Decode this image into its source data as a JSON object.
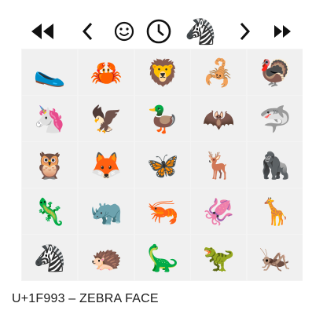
{
  "toolbar": {
    "buttons": [
      {
        "name": "first-page-button",
        "icon": "double-chevron-left-icon"
      },
      {
        "name": "previous-button",
        "icon": "chevron-left-icon"
      },
      {
        "name": "smileys-category-button",
        "icon": "smiley-icon"
      },
      {
        "name": "recent-category-button",
        "icon": "clock-icon"
      },
      {
        "name": "animals-category-button",
        "icon": "zebra-icon",
        "glyph": "🦓"
      },
      {
        "name": "next-button",
        "icon": "chevron-right-icon"
      },
      {
        "name": "last-page-button",
        "icon": "double-chevron-right-icon"
      }
    ]
  },
  "grid": {
    "emojis": [
      [
        "🥿",
        "🦀",
        "🦁",
        "🦂",
        "🦃"
      ],
      [
        "🦄",
        "🦅",
        "🦆",
        "🦇",
        "🦈"
      ],
      [
        "🦉",
        "🦊",
        "🦋",
        "🦌",
        "🦍"
      ],
      [
        "🦎",
        "🦏",
        "🦐",
        "🦑",
        "🦒"
      ],
      [
        "🦓",
        "🦔",
        "🦕",
        "🦖",
        "🦗"
      ]
    ]
  },
  "status": {
    "text": "U+1F993 – ZEBRA FACE"
  }
}
